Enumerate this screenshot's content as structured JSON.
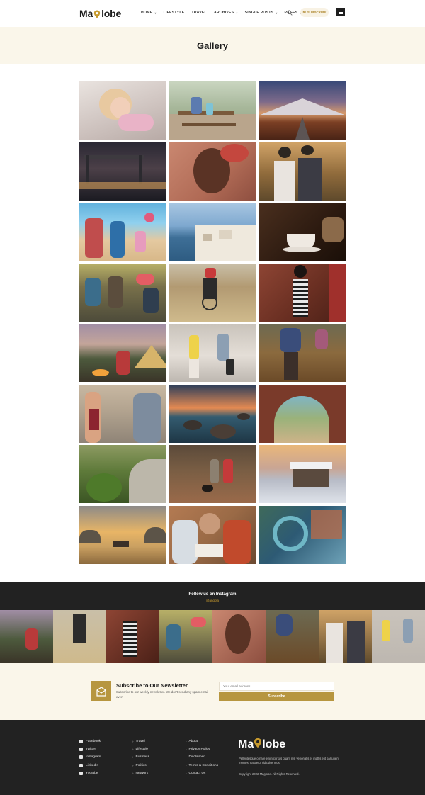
{
  "header": {
    "logo_pre": "Ma",
    "logo_post": "lobe",
    "nav": [
      {
        "label": "HOME",
        "has_dropdown": true
      },
      {
        "label": "LIFESTYLE",
        "has_dropdown": false
      },
      {
        "label": "TRAVEL",
        "has_dropdown": false
      },
      {
        "label": "ARCHIVES",
        "has_dropdown": true
      },
      {
        "label": "SINGLE POSTS",
        "has_dropdown": true
      },
      {
        "label": "PAGES",
        "has_dropdown": true
      }
    ],
    "subscribe_label": "SUBSCRIBE"
  },
  "page": {
    "title": "Gallery"
  },
  "instagram": {
    "title": "Follow us on Instagram",
    "handle": "@angola"
  },
  "newsletter": {
    "title": "Subscribe to Our Newsletter",
    "description": "Subscribe to our weekly newsletter. We don't send any spam email ever!",
    "placeholder": "Your email address...",
    "button_label": "Subscribe"
  },
  "footer": {
    "social": [
      "Facebook",
      "Twitter",
      "Instagram",
      "LinkedIn",
      "Youtube"
    ],
    "categories": [
      "Travel",
      "Lifestyle",
      "Business",
      "Politics",
      "Network"
    ],
    "pages": [
      "About",
      "Privacy Policy",
      "Disclaimer",
      "Terms & Conditions",
      "Contact Us"
    ],
    "logo_pre": "Ma",
    "logo_post": "lobe",
    "description": "Pellentesque ornare enim cursus quam nisi venenatis et mattis elit parturient montes, nascetur ridiculus mus.",
    "copyright": "Copyright 2022 Maglobe. All Rights Reserved."
  },
  "colors": {
    "accent": "#b7963f",
    "cream": "#faf6ea",
    "dark": "#222222"
  }
}
